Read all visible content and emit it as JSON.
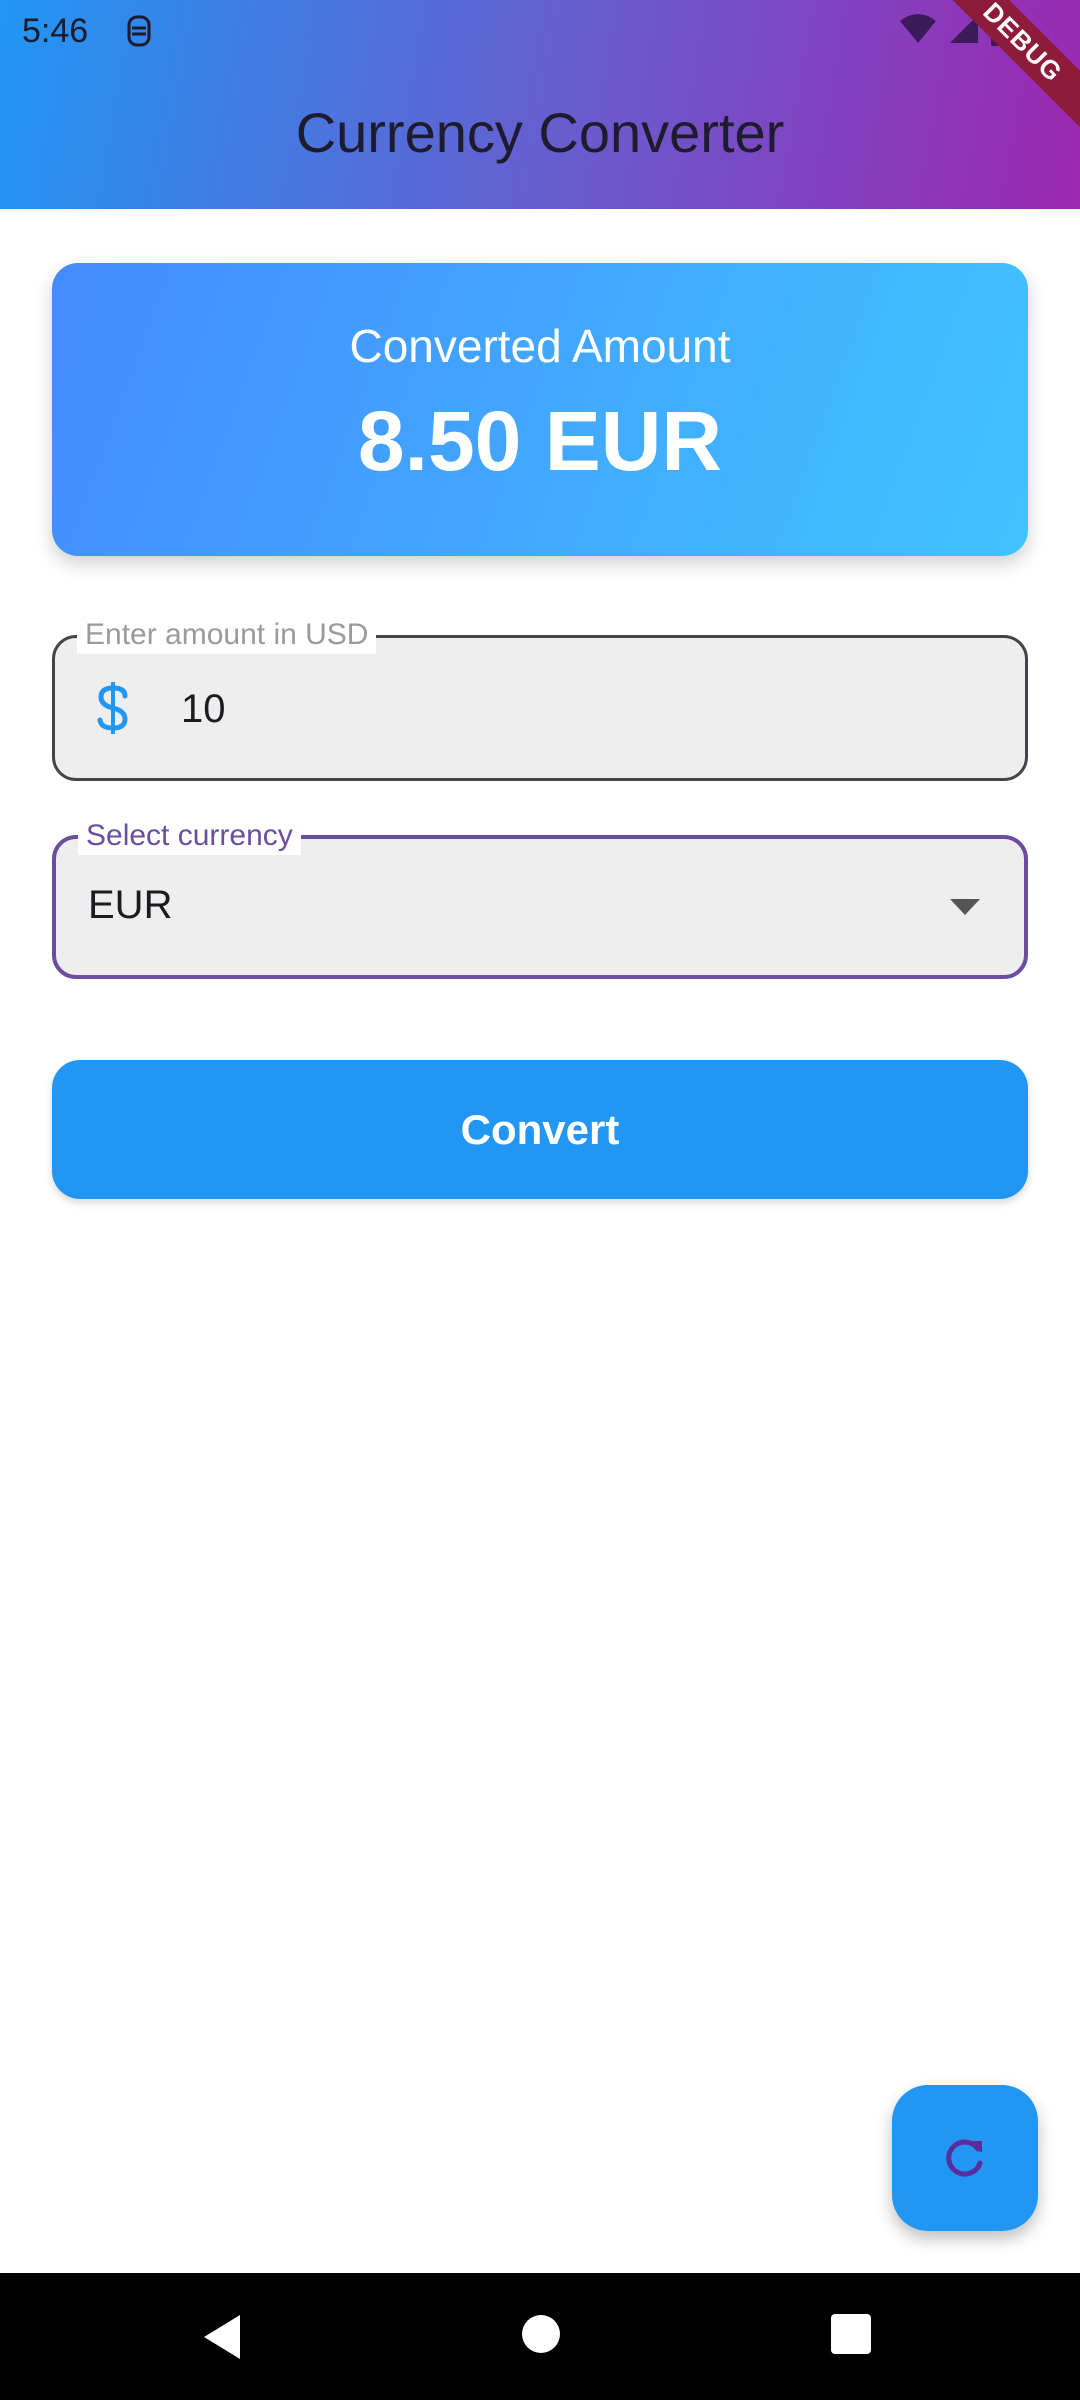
{
  "status_bar": {
    "time": "5:46",
    "left_icon": "notification-icon",
    "right_icons": [
      "wifi-icon",
      "cellular-signal-icon",
      "battery-icon"
    ]
  },
  "debug_banner": "DEBUG",
  "app_bar": {
    "title": "Currency Converter"
  },
  "result_card": {
    "label": "Converted Amount",
    "value": "8.50 EUR"
  },
  "amount_field": {
    "label": "Enter amount in USD",
    "value": "10",
    "prefix_icon": "dollar-icon"
  },
  "currency_field": {
    "label": "Select currency",
    "selected": "EUR",
    "icon": "dropdown-arrow-icon"
  },
  "convert_button": {
    "label": "Convert"
  },
  "fab": {
    "icon": "refresh-icon"
  },
  "navigation_bar": {
    "buttons": [
      "back-icon",
      "home-icon",
      "recents-icon"
    ]
  },
  "colors": {
    "primary": "#2196f3",
    "accent_purple": "#6b4ea0",
    "card_gradient_start": "#448aff",
    "card_gradient_end": "#40c4ff",
    "header_gradient_start": "#2196f3",
    "header_gradient_end": "#9c27b0"
  }
}
